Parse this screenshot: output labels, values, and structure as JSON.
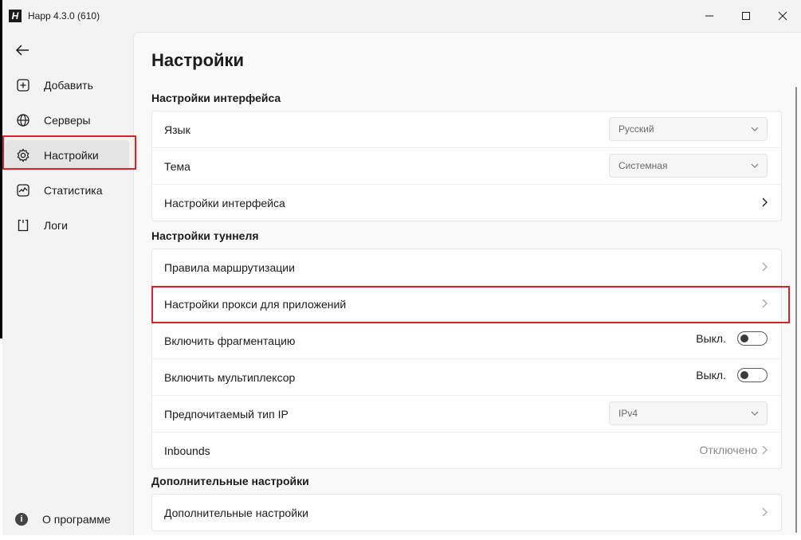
{
  "window": {
    "title": "Happ 4.3.0 (610)",
    "logo_text": "H"
  },
  "sidebar": {
    "items": [
      {
        "label": "Добавить",
        "icon": "add-square-icon"
      },
      {
        "label": "Серверы",
        "icon": "globe-icon"
      },
      {
        "label": "Настройки",
        "icon": "gear-icon"
      },
      {
        "label": "Статистика",
        "icon": "chart-icon"
      },
      {
        "label": "Логи",
        "icon": "log-icon"
      }
    ],
    "about_label": "О программе",
    "about_icon_text": "i"
  },
  "page": {
    "title": "Настройки",
    "sections": [
      {
        "title": "Настройки интерфейса",
        "rows": [
          {
            "label": "Язык",
            "value": "Русский"
          },
          {
            "label": "Тема",
            "value": "Системная"
          },
          {
            "label": "Настройки интерфейса"
          }
        ]
      },
      {
        "title": "Настройки туннеля",
        "rows": [
          {
            "label": "Правила маршрутизации"
          },
          {
            "label": "Настройки прокси для приложений"
          },
          {
            "label": "Включить фрагментацию",
            "state": "Выкл."
          },
          {
            "label": "Включить мультиплексор",
            "state": "Выкл."
          },
          {
            "label": "Предпочитаемый тип IP",
            "value": "IPv4"
          },
          {
            "label": "Inbounds",
            "value": "Отключено"
          }
        ]
      },
      {
        "title": "Дополнительные настройки",
        "rows": [
          {
            "label": "Дополнительные настройки"
          }
        ]
      }
    ]
  },
  "colors": {
    "highlight": "#d9232a",
    "background": "#f3f3f3",
    "card": "#ffffff"
  }
}
